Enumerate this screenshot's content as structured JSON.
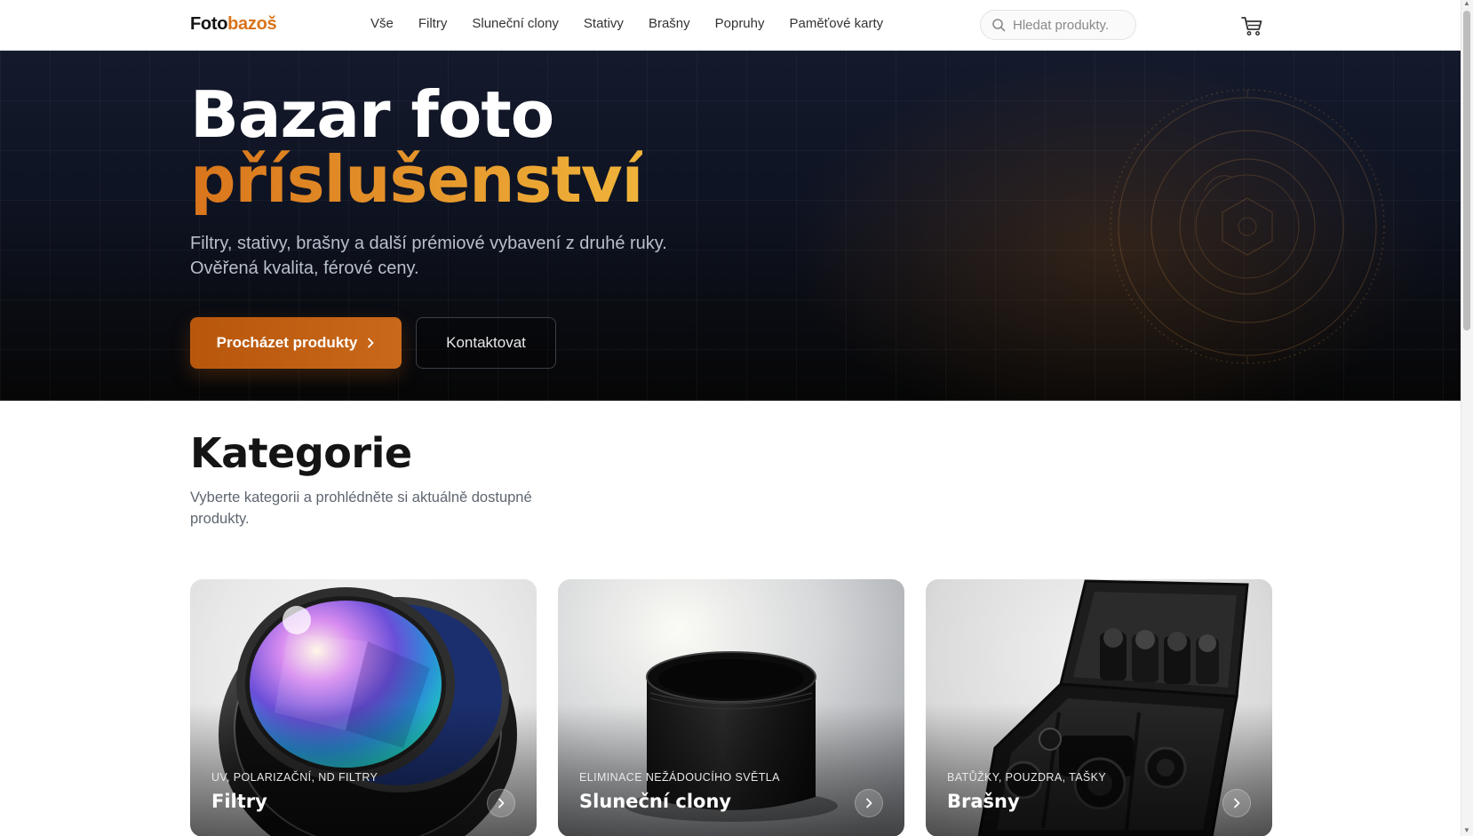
{
  "header": {
    "logo_part1": "Foto",
    "logo_part2": "bazoš",
    "nav": [
      "Vše",
      "Filtry",
      "Sluneční clony",
      "Stativy",
      "Brašny",
      "Popruhy",
      "Paměťové karty"
    ],
    "search_placeholder": "Hledat produkty.",
    "cart_icon": "cart-icon"
  },
  "hero": {
    "title_line1": "Bazar foto",
    "title_line2": "příslušenství",
    "subtitle_line1": "Filtry, stativy, brašny a další prémiové vybavení z druhé ruky.",
    "subtitle_line2": "Ověřená kvalita, férové ceny.",
    "primary_button": "Procházet produkty",
    "secondary_button": "Kontaktovat"
  },
  "categories": {
    "title": "Kategorie",
    "subtitle": "Vyberte kategorii a prohlédněte si aktuálně dostupné produkty.",
    "items": [
      {
        "tag": "UV, polarizační, ND filtry",
        "name": "Filtry"
      },
      {
        "tag": "Eliminace nežádoucího světla",
        "name": "Sluneční clony"
      },
      {
        "tag": "Batůžky, pouzdra, tašky",
        "name": "Brašny"
      }
    ]
  },
  "colors": {
    "accent": "#d9731a",
    "accent_gradient_end": "#f0b43a",
    "hero_bg": "#0e1322"
  }
}
